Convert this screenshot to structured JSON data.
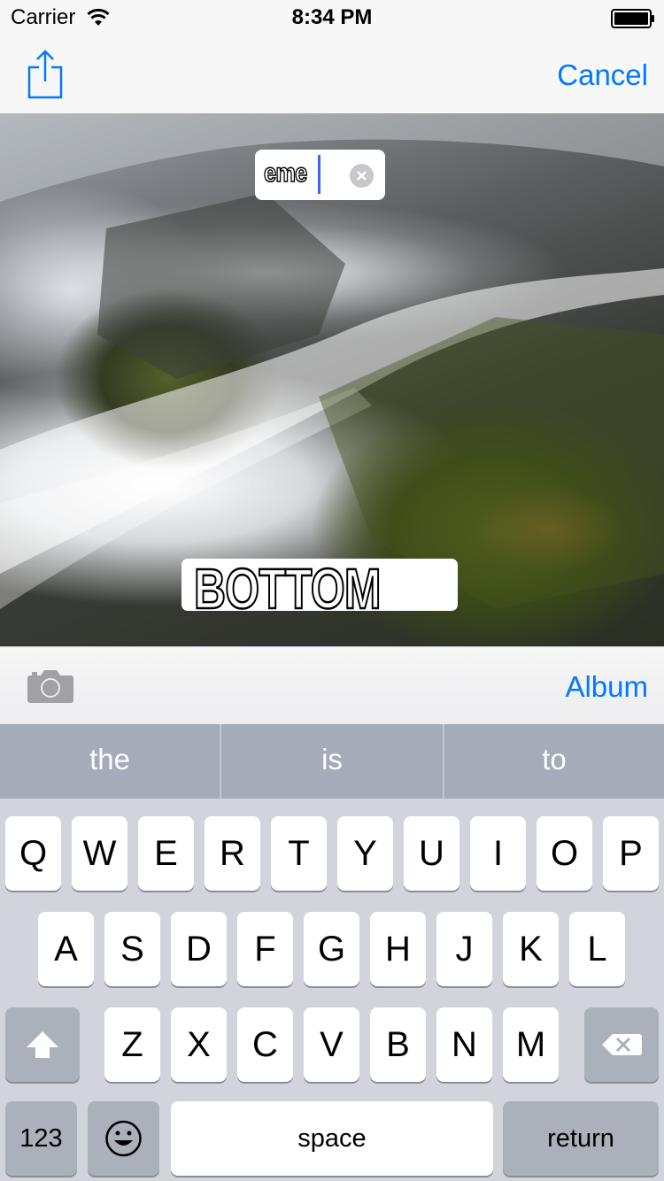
{
  "status_bar": {
    "carrier": "Carrier",
    "time": "8:34 PM"
  },
  "nav_bar": {
    "cancel_label": "Cancel",
    "share_icon": "share-icon"
  },
  "meme": {
    "top_text": "eme",
    "bottom_text": "BOTTOM"
  },
  "toolbar": {
    "camera_icon": "camera-icon",
    "album_label": "Album"
  },
  "predictive": {
    "suggestions": [
      "the",
      "is",
      "to"
    ]
  },
  "keyboard": {
    "row1": [
      "Q",
      "W",
      "E",
      "R",
      "T",
      "Y",
      "U",
      "I",
      "O",
      "P"
    ],
    "row2": [
      "A",
      "S",
      "D",
      "F",
      "G",
      "H",
      "J",
      "K",
      "L"
    ],
    "row3": [
      "Z",
      "X",
      "C",
      "V",
      "B",
      "N",
      "M"
    ],
    "numbers_label": "123",
    "space_label": "space",
    "return_label": "return"
  },
  "colors": {
    "accent": "#007aff",
    "keyboard_bg": "#d1d5db",
    "predictive_bg": "#a3acb8",
    "caret": "#3f64f0"
  }
}
